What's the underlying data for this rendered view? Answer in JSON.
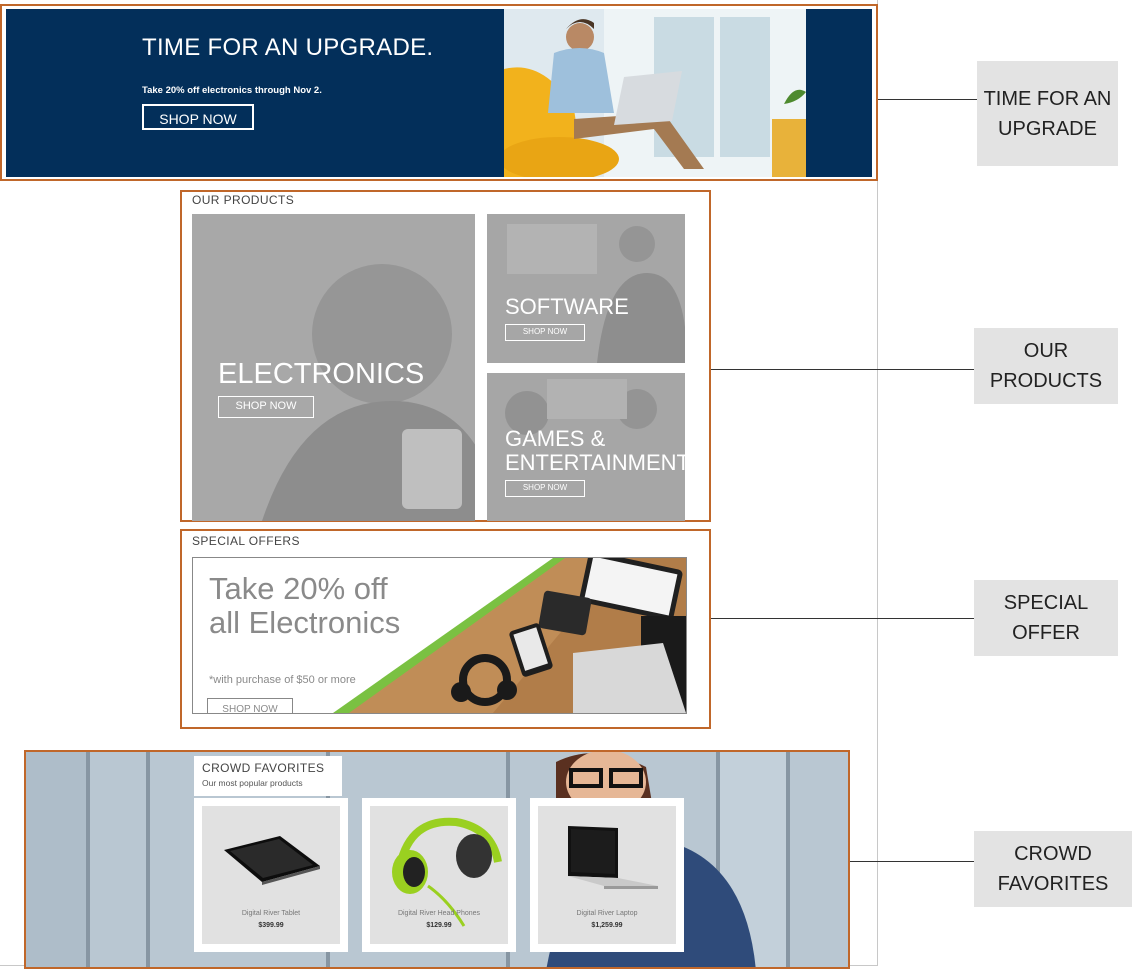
{
  "hero": {
    "title": "TIME FOR AN UPGRADE.",
    "subtitle": "Take 20% off electronics through Nov 2.",
    "button": "SHOP NOW",
    "background": "#032f5a"
  },
  "products": {
    "section_title": "OUR PRODUCTS",
    "tiles": [
      {
        "label": "ELECTRONICS",
        "button": "SHOP NOW"
      },
      {
        "label": "SOFTWARE",
        "button": "SHOP NOW"
      },
      {
        "label": "GAMES & ENTERTAINMENT",
        "button": "SHOP NOW"
      }
    ]
  },
  "special": {
    "section_title": "SPECIAL OFFERS",
    "headline": "Take 20% off all Electronics",
    "note": "*with purchase of $50 or more",
    "button": "SHOP NOW",
    "accent": "#7ac142"
  },
  "crowd": {
    "title": "CROWD FAVORITES",
    "subtitle": "Our most popular products",
    "items": [
      {
        "name": "Digital River Tablet",
        "price": "$399.99",
        "icon": "tablet-icon"
      },
      {
        "name": "Digital River Head Phones",
        "price": "$129.99",
        "icon": "headphones-icon"
      },
      {
        "name": "Digital River Laptop",
        "price": "$1,259.99",
        "icon": "laptop-icon"
      }
    ]
  },
  "callouts": {
    "hero": "TIME FOR AN UPGRADE",
    "products": "OUR PRODUCTS",
    "special": "SPECIAL OFFER",
    "crowd": "CROWD FAVORITES"
  },
  "colors": {
    "outline": "#c0672a",
    "callout_bg": "#e3e3e3"
  }
}
